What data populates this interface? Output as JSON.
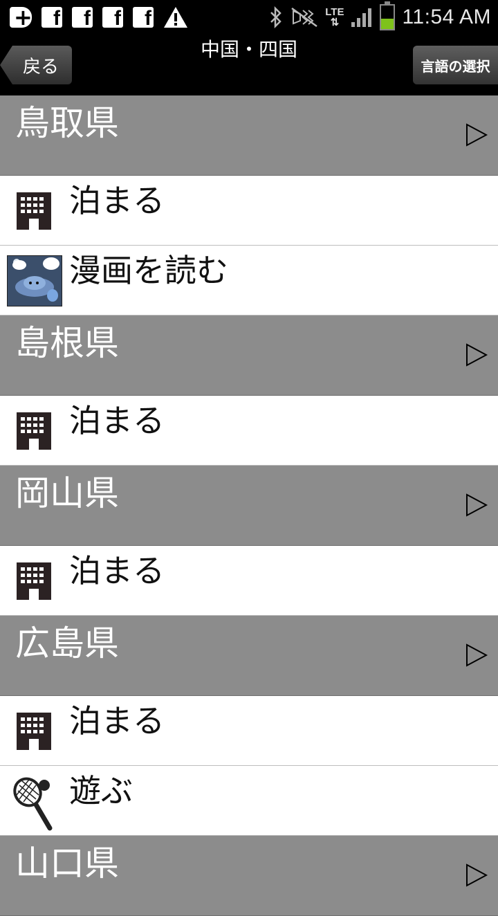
{
  "status_bar": {
    "time": "11:54 AM",
    "network": "LTE",
    "icons": [
      "add-icon",
      "facebook-icon",
      "facebook-icon",
      "facebook-icon",
      "facebook-icon",
      "warning-icon",
      "bluetooth-icon",
      "mute-icon",
      "lte-icon",
      "signal-icon",
      "battery-icon"
    ]
  },
  "nav": {
    "back_label": "戻る",
    "title": "中国・四国",
    "language_label": "言語の選択"
  },
  "sections": [
    {
      "label": "鳥取県",
      "items": [
        {
          "label": "泊まる",
          "icon": "hotel-building-icon"
        },
        {
          "label": "漫画を読む",
          "icon": "manga-thumbnail"
        }
      ]
    },
    {
      "label": "島根県",
      "items": [
        {
          "label": "泊まる",
          "icon": "hotel-building-icon"
        }
      ]
    },
    {
      "label": "岡山県",
      "items": [
        {
          "label": "泊まる",
          "icon": "hotel-building-icon"
        }
      ]
    },
    {
      "label": "広島県",
      "items": [
        {
          "label": "泊まる",
          "icon": "hotel-building-icon"
        },
        {
          "label": "遊ぶ",
          "icon": "tennis-racket-icon"
        }
      ]
    },
    {
      "label": "山口県",
      "items": []
    }
  ],
  "colors": {
    "section_bg": "#8c8c8c",
    "nav_bg": "#000000",
    "battery": "#7ec21b"
  }
}
